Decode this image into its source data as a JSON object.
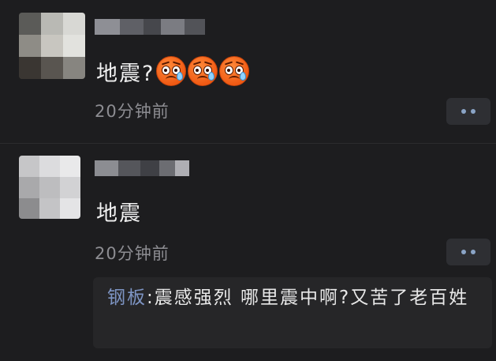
{
  "comments": [
    {
      "content_text": "地震?",
      "emojis": [
        "worried-sweat-face-icon",
        "worried-sweat-face-icon",
        "worried-sweat-face-icon"
      ],
      "time": "20分钟前",
      "more_icon": "more-dots-icon"
    },
    {
      "content_text": "地震",
      "time": "20分钟前",
      "more_icon": "more-dots-icon",
      "reply": {
        "author": "钢板",
        "separator": ":",
        "text": "震感强烈 哪里震中啊?又苦了老百姓"
      }
    }
  ],
  "colors": {
    "background": "#1d1d1f",
    "reply_author": "#7d94c3",
    "time_text": "#8d8d92",
    "more_button_bg": "#2e2f33",
    "more_dots": "#8aa4c6"
  }
}
